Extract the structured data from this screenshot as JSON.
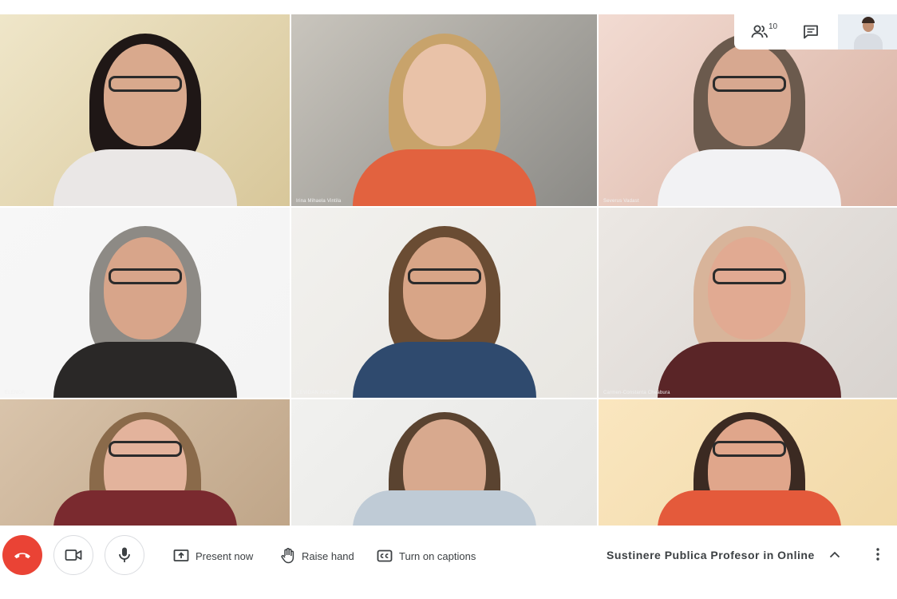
{
  "participants": [
    {
      "name": "",
      "bg": "#d8c79a",
      "wall": "#efe6c9",
      "skin": "#d9a98d",
      "hair": "#1f1716",
      "shirt": "#eae7e6",
      "glasses": true
    },
    {
      "name": "Irina Mihaela Vintila",
      "bg": "#8b8a86",
      "wall": "#c9c5bd",
      "skin": "#e9c2a8",
      "hair": "#c8a36b",
      "shirt": "#e2623f",
      "glasses": false
    },
    {
      "name": "Severus Vadast",
      "bg": "#d9b2a3",
      "wall": "#f2dbd2",
      "skin": "#d7a890",
      "hair": "#6b5a4d",
      "shirt": "#f2f2f4",
      "glasses": true
    },
    {
      "name": "ELENCA",
      "bg": "#f4f4f4",
      "wall": "#f7f7f7",
      "skin": "#d8a58a",
      "hair": "#8d8a85",
      "shirt": "#2a2827",
      "glasses": true
    },
    {
      "name": "CEVIDAN ANDREI",
      "bg": "#e8e6e1",
      "wall": "#f2f1ee",
      "skin": "#d8a587",
      "hair": "#6a4c33",
      "shirt": "#2f4a6e",
      "glasses": true
    },
    {
      "name": "Carmen-Constanta Cheabura",
      "bg": "#d8d3cf",
      "wall": "#ece8e4",
      "skin": "#e1aa92",
      "hair": "#d8b49a",
      "shirt": "#5a2527",
      "glasses": true
    },
    {
      "name": "",
      "bg": "#bfa588",
      "wall": "#d9c4ab",
      "skin": "#e3b39c",
      "hair": "#8a6a4a",
      "shirt": "#7a2a2f",
      "glasses": true
    },
    {
      "name": "",
      "bg": "#e6e6e4",
      "wall": "#f1f1ef",
      "skin": "#d8a98e",
      "hair": "#5a4330",
      "shirt": "#bfcbd6",
      "glasses": false
    },
    {
      "name": "",
      "bg": "#f1d9a8",
      "wall": "#fae6bf",
      "skin": "#e0a68b",
      "hair": "#3b2a22",
      "shirt": "#e45a3b",
      "glasses": true
    }
  ],
  "top_panel": {
    "people_count": "10",
    "people_icon": "people-icon",
    "chat_icon": "chat-icon"
  },
  "controls": {
    "hangup_icon": "hang-up-icon",
    "camera_icon": "camera-icon",
    "mic_icon": "microphone-icon",
    "present_label": "Present now",
    "raise_label": "Raise hand",
    "captions_label": "Turn on captions"
  },
  "meeting": {
    "title": "Sustinere Publica Profesor in Online"
  },
  "colors": {
    "hangup": "#ea4335",
    "text": "#3c4043"
  }
}
